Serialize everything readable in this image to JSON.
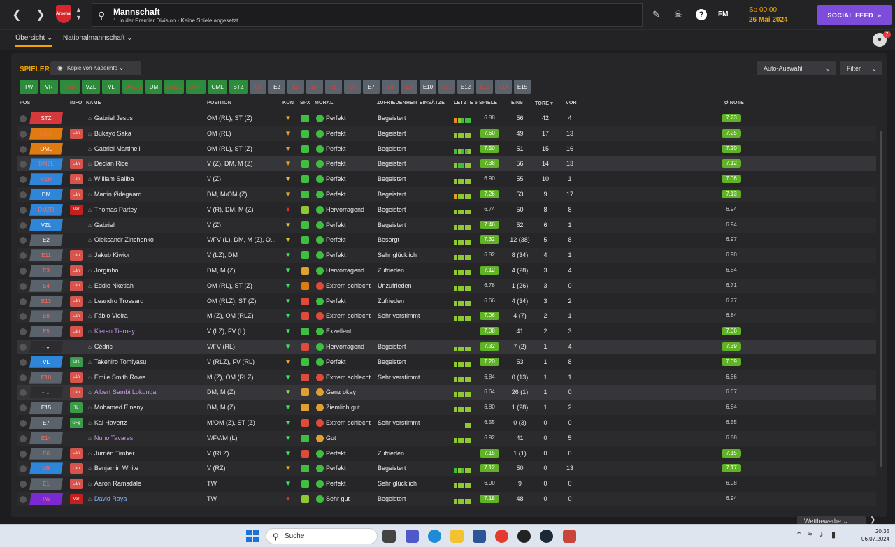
{
  "header": {
    "title": "Mannschaft",
    "subtitle": "1. in der Premier Division - Keine Spiele angesetzt",
    "club_badge": "Arsenal",
    "date_top": "So 00:00",
    "date_bottom": "26 Mai 2024",
    "social_feed": "SOCIAL FEED",
    "fm": "FM",
    "notif_count": "7"
  },
  "tabs": [
    "Übersicht",
    "Nationalmannschaft"
  ],
  "toolbar": {
    "section": "SPIELER",
    "view": "Kopie von Kaderinfo",
    "auto": "Auto-Auswahl",
    "filter": "Filter"
  },
  "chips": [
    [
      "TW",
      "g"
    ],
    [
      "VR",
      "g"
    ],
    [
      "VZR",
      "gr"
    ],
    [
      "VZL",
      "g"
    ],
    [
      "VL",
      "g"
    ],
    [
      "DMZR",
      "gr"
    ],
    [
      "DM",
      "g"
    ],
    [
      "DMZL",
      "gr"
    ],
    [
      "OMR",
      "gr"
    ],
    [
      "OML",
      "g"
    ],
    [
      "STZ",
      "g"
    ],
    [
      "E1",
      "sr"
    ],
    [
      "E2",
      "s"
    ],
    [
      "E3",
      "sr"
    ],
    [
      "E4",
      "sr"
    ],
    [
      "E5",
      "sr"
    ],
    [
      "E6",
      "sr"
    ],
    [
      "E7",
      "s"
    ],
    [
      "E8",
      "sr"
    ],
    [
      "E9",
      "sr"
    ],
    [
      "E10",
      "s"
    ],
    [
      "E11",
      "sr"
    ],
    [
      "E12",
      "s"
    ],
    [
      "E13",
      "sr"
    ],
    [
      "E14",
      "sr"
    ],
    [
      "E15",
      "s"
    ]
  ],
  "columns": {
    "pos": "POS",
    "info": "INFO",
    "name": "NAME",
    "position": "POSITION",
    "kon": "KON",
    "spx": "SPX",
    "moral": "MORAL",
    "zuf": "ZUFRIEDENHEIT EINSÄTZE",
    "form": "LETZTE 5 SPIELE",
    "eins": "EINS",
    "tore": "TORE",
    "vor": "VOR",
    "note": "Ø NOTE"
  },
  "players": [
    {
      "pos": "STZ",
      "pc": "#d6393c",
      "pr": false,
      "info": "",
      "ic": "",
      "name": "Gabriel Jesus",
      "nc": "#e8e8e8",
      "position": "OM (RL), ST (Z)",
      "kon": "#e0a030",
      "spx": "#3fbf3f",
      "mc": "#3fbf3f",
      "moral": "Perfekt",
      "zuf": "Begeistert",
      "form": [
        "#f08a24",
        "#8fc833",
        "#3fbf3f",
        "#3fbf3f",
        "#3fbf3f"
      ],
      "rat": "6.88",
      "rg": false,
      "eins": "56",
      "tore": "42",
      "vor": "4",
      "note": "7.23",
      "ng": true
    },
    {
      "pos": "OMR",
      "pc": "#e07b12",
      "pr": true,
      "info": "Län",
      "ic": "#d6544c",
      "name": "Bukayo Saka",
      "nc": "#e8e8e8",
      "position": "OM (RL)",
      "kon": "#e0a030",
      "spx": "#3fbf3f",
      "mc": "#3fbf3f",
      "moral": "Perfekt",
      "zuf": "Begeistert",
      "form": [
        "#8fc833",
        "#8fc833",
        "#8fc833",
        "#8fc833",
        "#8fc833"
      ],
      "rat": "7.60",
      "rg": true,
      "eins": "49",
      "tore": "17",
      "vor": "13",
      "note": "7.25",
      "ng": true
    },
    {
      "pos": "OML",
      "pc": "#e07b12",
      "pr": false,
      "info": "",
      "ic": "",
      "name": "Gabriel Martinelli",
      "nc": "#e8e8e8",
      "position": "OM (RL), ST (Z)",
      "kon": "#e0a030",
      "spx": "#3fbf3f",
      "mc": "#3fbf3f",
      "moral": "Perfekt",
      "zuf": "Begeistert",
      "form": [
        "#3fbf3f",
        "#8fc833",
        "#3fbf3f",
        "#3fbf3f",
        "#8fc833"
      ],
      "rat": "7.50",
      "rg": true,
      "eins": "51",
      "tore": "15",
      "vor": "16",
      "note": "7.20",
      "ng": true
    },
    {
      "pos": "DMZL",
      "pc": "#2f86d8",
      "pr": true,
      "info": "Län",
      "ic": "#d6544c",
      "name": "Declan Rice",
      "nc": "#e8e8e8",
      "position": "V (Z), DM, M (Z)",
      "kon": "#e0a030",
      "spx": "#3fbf3f",
      "mc": "#3fbf3f",
      "moral": "Perfekt",
      "zuf": "Begeistert",
      "form": [
        "#8fc833",
        "#3fbf3f",
        "#3fbf3f",
        "#8fc833",
        "#8fc833"
      ],
      "rat": "7.38",
      "rg": true,
      "eins": "56",
      "tore": "14",
      "vor": "13",
      "note": "7.12",
      "ng": true
    },
    {
      "pos": "VZR",
      "pc": "#2f86d8",
      "pr": true,
      "info": "Län",
      "ic": "#d6544c",
      "name": "William Saliba",
      "nc": "#e8e8e8",
      "position": "V (Z)",
      "kon": "#e0c030",
      "spx": "#3fbf3f",
      "mc": "#3fbf3f",
      "moral": "Perfekt",
      "zuf": "Begeistert",
      "form": [
        "#8fc833",
        "#8fc833",
        "#8fc833",
        "#8fc833",
        "#8fc833"
      ],
      "rat": "6.90",
      "rg": false,
      "eins": "55",
      "tore": "10",
      "vor": "1",
      "note": "7.06",
      "ng": true
    },
    {
      "pos": "DM",
      "pc": "#2f86d8",
      "pr": false,
      "info": "Län",
      "ic": "#d6544c",
      "name": "Martin Ødegaard",
      "nc": "#e8e8e8",
      "position": "DM, M/OM (Z)",
      "kon": "#e0a030",
      "spx": "#3fbf3f",
      "mc": "#3fbf3f",
      "moral": "Perfekt",
      "zuf": "Begeistert",
      "form": [
        "#e0a030",
        "#8fc833",
        "#8fc833",
        "#8fc833",
        "#8fc833"
      ],
      "rat": "7.26",
      "rg": true,
      "eins": "53",
      "tore": "9",
      "vor": "17",
      "note": "7.13",
      "ng": true
    },
    {
      "pos": "DMZR",
      "pc": "#2f86d8",
      "pr": true,
      "info": "Ver",
      "ic": "#c42020",
      "name": "Thomas Partey",
      "nc": "#e8e8e8",
      "position": "V (R), DM, M (Z)",
      "kon": "#d03030",
      "spx": "#8fc833",
      "mc": "#3fbf3f",
      "moral": "Hervorragend",
      "zuf": "Begeistert",
      "form": [
        "#8fc833",
        "#8fc833",
        "#8fc833",
        "#8fc833",
        "#8fc833"
      ],
      "rat": "6.74",
      "rg": false,
      "eins": "50",
      "tore": "8",
      "vor": "8",
      "note": "6.94",
      "ng": false
    },
    {
      "pos": "VZL",
      "pc": "#2f86d8",
      "pr": false,
      "info": "",
      "ic": "",
      "name": "Gabriel",
      "nc": "#e8e8e8",
      "position": "V (Z)",
      "kon": "#e0c030",
      "spx": "#3fbf3f",
      "mc": "#3fbf3f",
      "moral": "Perfekt",
      "zuf": "Begeistert",
      "form": [
        "#8fc833",
        "#8fc833",
        "#8fc833",
        "#8fc833",
        "#8fc833"
      ],
      "rat": "7.46",
      "rg": true,
      "eins": "52",
      "tore": "6",
      "vor": "1",
      "note": "6.94",
      "ng": false
    },
    {
      "pos": "E2",
      "pc": "#5a636c",
      "pr": false,
      "info": "",
      "ic": "",
      "name": "Oleksandr Zinchenko",
      "nc": "#e8e8e8",
      "position": "V/FV (L), DM, M (Z), O...",
      "kon": "#e0c030",
      "spx": "#3fbf3f",
      "mc": "#3fbf3f",
      "moral": "Perfekt",
      "zuf": "Besorgt",
      "form": [
        "#8fc833",
        "#8fc833",
        "#8fc833",
        "#8fc833",
        "#8fc833"
      ],
      "rat": "7.32",
      "rg": true,
      "eins": "12 (38)",
      "tore": "5",
      "vor": "8",
      "note": "6.97",
      "ng": false
    },
    {
      "pos": "E11",
      "pc": "#5a636c",
      "pr": true,
      "info": "Län",
      "ic": "#d6544c",
      "name": "Jakub Kiwior",
      "nc": "#e8e8e8",
      "position": "V (LZ), DM",
      "kon": "#3fdf5f",
      "spx": "#3fbf3f",
      "mc": "#3fbf3f",
      "moral": "Perfekt",
      "zuf": "Sehr glücklich",
      "form": [
        "#8fc833",
        "#8fc833",
        "#8fc833",
        "#8fc833",
        "#8fc833"
      ],
      "rat": "6.82",
      "rg": false,
      "eins": "8 (34)",
      "tore": "4",
      "vor": "1",
      "note": "6.90",
      "ng": false
    },
    {
      "pos": "E3",
      "pc": "#5a636c",
      "pr": true,
      "info": "Län",
      "ic": "#d6544c",
      "name": "Jorginho",
      "nc": "#e8e8e8",
      "position": "DM, M (Z)",
      "kon": "#3fdf5f",
      "spx": "#e0a030",
      "mc": "#3fbf3f",
      "moral": "Hervorragend",
      "zuf": "Zufrieden",
      "form": [
        "#8fc833",
        "#8fc833",
        "#8fc833",
        "#8fc833",
        "#8fc833"
      ],
      "rat": "7.12",
      "rg": true,
      "eins": "4 (28)",
      "tore": "3",
      "vor": "4",
      "note": "6.84",
      "ng": false
    },
    {
      "pos": "E4",
      "pc": "#5a636c",
      "pr": true,
      "info": "Län",
      "ic": "#d6544c",
      "name": "Eddie Nketiah",
      "nc": "#e8e8e8",
      "position": "OM (RL), ST (Z)",
      "kon": "#3fdf5f",
      "spx": "#e07b12",
      "mc": "#e04a3a",
      "moral": "Extrem schlecht",
      "zuf": "Unzufrieden",
      "form": [
        "#8fc833",
        "#8fc833",
        "#8fc833",
        "#8fc833",
        "#8fc833"
      ],
      "rat": "6.78",
      "rg": false,
      "eins": "1 (26)",
      "tore": "3",
      "vor": "0",
      "note": "6.71",
      "ng": false
    },
    {
      "pos": "E13",
      "pc": "#5a636c",
      "pr": true,
      "info": "Län",
      "ic": "#d6544c",
      "name": "Leandro Trossard",
      "nc": "#e8e8e8",
      "position": "OM (RLZ), ST (Z)",
      "kon": "#3fdf5f",
      "spx": "#e04a3a",
      "mc": "#3fbf3f",
      "moral": "Perfekt",
      "zuf": "Zufrieden",
      "form": [
        "#8fc833",
        "#8fc833",
        "#8fc833",
        "#8fc833",
        "#8fc833"
      ],
      "rat": "6.66",
      "rg": false,
      "eins": "4 (34)",
      "tore": "3",
      "vor": "2",
      "note": "6.77",
      "ng": false
    },
    {
      "pos": "E8",
      "pc": "#5a636c",
      "pr": true,
      "info": "Län",
      "ic": "#d6544c",
      "name": "Fábio Vieira",
      "nc": "#e8e8e8",
      "position": "M (Z), OM (RLZ)",
      "kon": "#3fdf5f",
      "spx": "#e04a3a",
      "mc": "#e04a3a",
      "moral": "Extrem schlecht",
      "zuf": "Sehr verstimmt",
      "form": [
        "#8fc833",
        "#8fc833",
        "#8fc833",
        "#8fc833",
        "#8fc833"
      ],
      "rat": "7.06",
      "rg": true,
      "eins": "4 (7)",
      "tore": "2",
      "vor": "1",
      "note": "6.84",
      "ng": false
    },
    {
      "pos": "E5",
      "pc": "#5a636c",
      "pr": true,
      "info": "Län",
      "ic": "#d6544c",
      "name": "Kieran Tierney",
      "nc": "#c59be8",
      "position": "V (LZ), FV (L)",
      "kon": "#3fdf5f",
      "spx": "#3fbf3f",
      "mc": "#3fbf3f",
      "moral": "Exzellent",
      "zuf": "",
      "form": [],
      "rat": "7.08",
      "rg": true,
      "eins": "41",
      "tore": "2",
      "vor": "3",
      "note": "7.06",
      "ng": true
    },
    {
      "pos": "-",
      "pc": "#2d2d30",
      "pr": false,
      "info": "",
      "ic": "",
      "name": "Cédric",
      "nc": "#e8e8e8",
      "position": "V/FV (RL)",
      "kon": "#3fdf5f",
      "spx": "#e04a3a",
      "mc": "#3fbf3f",
      "moral": "Hervorragend",
      "zuf": "Begeistert",
      "form": [
        "#8fc833",
        "#8fc833",
        "#8fc833",
        "#8fc833",
        "#8fc833"
      ],
      "rat": "7.32",
      "rg": true,
      "eins": "7 (2)",
      "tore": "1",
      "vor": "4",
      "note": "7.39",
      "ng": true
    },
    {
      "pos": "VL",
      "pc": "#2f86d8",
      "pr": false,
      "info": "Unt",
      "ic": "#3b9b4b",
      "name": "Takehiro Tomiyasu",
      "nc": "#e8e8e8",
      "position": "V (RLZ), FV (RL)",
      "kon": "#e0a030",
      "spx": "#3fbf3f",
      "mc": "#3fbf3f",
      "moral": "Perfekt",
      "zuf": "Begeistert",
      "form": [
        "#8fc833",
        "#8fc833",
        "#8fc833",
        "#8fc833",
        "#8fc833"
      ],
      "rat": "7.20",
      "rg": true,
      "eins": "53",
      "tore": "1",
      "vor": "8",
      "note": "7.09",
      "ng": true
    },
    {
      "pos": "E10",
      "pc": "#5a636c",
      "pr": true,
      "info": "Län",
      "ic": "#d6544c",
      "name": "Emile Smith Rowe",
      "nc": "#e8e8e8",
      "position": "M (Z), OM (RLZ)",
      "kon": "#3fdf5f",
      "spx": "#e04a3a",
      "mc": "#e04a3a",
      "moral": "Extrem schlecht",
      "zuf": "Sehr verstimmt",
      "form": [
        "#8fc833",
        "#8fc833",
        "#8fc833",
        "#8fc833",
        "#8fc833"
      ],
      "rat": "6.84",
      "rg": false,
      "eins": "0 (13)",
      "tore": "1",
      "vor": "1",
      "note": "6.86",
      "ng": false
    },
    {
      "pos": "-",
      "pc": "#2d2d30",
      "pr": false,
      "info": "Län",
      "ic": "#d6544c",
      "name": "Albert Sambi Lokonga",
      "nc": "#c59be8",
      "position": "DM, M (Z)",
      "kon": "#8fdf5f",
      "spx": "#e0a030",
      "mc": "#e0a030",
      "moral": "Ganz okay",
      "zuf": "",
      "form": [
        "#8fc833",
        "#8fc833",
        "#8fc833",
        "#8fc833",
        "#8fc833"
      ],
      "rat": "6.64",
      "rg": false,
      "eins": "26 (1)",
      "tore": "1",
      "vor": "0",
      "note": "6.67",
      "ng": false
    },
    {
      "pos": "E15",
      "pc": "#5a636c",
      "pr": false,
      "info": "TL",
      "ic": "#3b9b4b",
      "name": "Mohamed Elneny",
      "nc": "#e8e8e8",
      "position": "DM, M (Z)",
      "kon": "#3fdf5f",
      "spx": "#e0a030",
      "mc": "#e0a030",
      "moral": "Ziemlich gut",
      "zuf": "",
      "form": [
        "#8fc833",
        "#8fc833",
        "#8fc833",
        "#8fc833",
        "#8fc833"
      ],
      "rat": "6.80",
      "rg": false,
      "eins": "1 (28)",
      "tore": "1",
      "vor": "2",
      "note": "6.84",
      "ng": false
    },
    {
      "pos": "E7",
      "pc": "#5a636c",
      "pr": false,
      "info": "UFg",
      "ic": "#3b9b4b",
      "name": "Kai Havertz",
      "nc": "#e8e8e8",
      "position": "M/OM (Z), ST (Z)",
      "kon": "#3fdf5f",
      "spx": "#e04a3a",
      "mc": "#e04a3a",
      "moral": "Extrem schlecht",
      "zuf": "Sehr verstimmt",
      "form": [
        "#8fc833",
        "#8fc833"
      ],
      "rat": "6.55",
      "rg": false,
      "eins": "0 (3)",
      "tore": "0",
      "vor": "0",
      "note": "6.55",
      "ng": false
    },
    {
      "pos": "E14",
      "pc": "#5a636c",
      "pr": true,
      "info": "",
      "ic": "",
      "name": "Nuno Tavares",
      "nc": "#c59be8",
      "position": "V/FV/M (L)",
      "kon": "#3fdf5f",
      "spx": "#3fbf3f",
      "mc": "#e0a030",
      "moral": "Gut",
      "zuf": "",
      "form": [
        "#8fc833",
        "#8fc833",
        "#8fc833",
        "#8fc833",
        "#8fc833"
      ],
      "rat": "6.92",
      "rg": false,
      "eins": "41",
      "tore": "0",
      "vor": "5",
      "note": "6.88",
      "ng": false
    },
    {
      "pos": "E6",
      "pc": "#5a636c",
      "pr": true,
      "info": "Län",
      "ic": "#d6544c",
      "name": "Jurriën Timber",
      "nc": "#e8e8e8",
      "position": "V (RLZ)",
      "kon": "#3fdf5f",
      "spx": "#e04a3a",
      "mc": "#3fbf3f",
      "moral": "Perfekt",
      "zuf": "Zufrieden",
      "form": [],
      "rat": "7.15",
      "rg": true,
      "eins": "1 (1)",
      "tore": "0",
      "vor": "0",
      "note": "7.15",
      "ng": true
    },
    {
      "pos": "VR",
      "pc": "#2f86d8",
      "pr": true,
      "info": "Län",
      "ic": "#d6544c",
      "name": "Benjamin White",
      "nc": "#e8e8e8",
      "position": "V (RZ)",
      "kon": "#e0a030",
      "spx": "#3fbf3f",
      "mc": "#3fbf3f",
      "moral": "Perfekt",
      "zuf": "Begeistert",
      "form": [
        "#3fbf3f",
        "#8fc833",
        "#3fbf3f",
        "#8fc833",
        "#8fc833"
      ],
      "rat": "7.12",
      "rg": true,
      "eins": "50",
      "tore": "0",
      "vor": "13",
      "note": "7.17",
      "ng": true
    },
    {
      "pos": "E1",
      "pc": "#5a636c",
      "pr": true,
      "info": "Län",
      "ic": "#d6544c",
      "name": "Aaron Ramsdale",
      "nc": "#e8e8e8",
      "position": "TW",
      "kon": "#3fdf5f",
      "spx": "#3fbf3f",
      "mc": "#3fbf3f",
      "moral": "Perfekt",
      "zuf": "Sehr glücklich",
      "form": [
        "#8fc833",
        "#8fc833",
        "#8fc833",
        "#8fc833",
        "#8fc833"
      ],
      "rat": "6.90",
      "rg": false,
      "eins": "9",
      "tore": "0",
      "vor": "0",
      "note": "6.98",
      "ng": false
    },
    {
      "pos": "TW",
      "pc": "#7a2ad0",
      "pr": true,
      "info": "Ver",
      "ic": "#c42020",
      "name": "David Raya",
      "nc": "#7fb6ff",
      "position": "TW",
      "kon": "#d03030",
      "spx": "#8fc833",
      "mc": "#3fbf3f",
      "moral": "Sehr gut",
      "zuf": "Begeistert",
      "form": [
        "#8fc833",
        "#8fc833",
        "#8fc833",
        "#8fc833",
        "#8fc833"
      ],
      "rat": "7.18",
      "rg": true,
      "eins": "48",
      "tore": "0",
      "vor": "0",
      "note": "6.94",
      "ng": false
    }
  ],
  "footer": {
    "wettbewerbe": "Wettbewerbe"
  },
  "taskbar": {
    "search": "Suche",
    "time": "20:35",
    "date": "06.07.2024"
  }
}
